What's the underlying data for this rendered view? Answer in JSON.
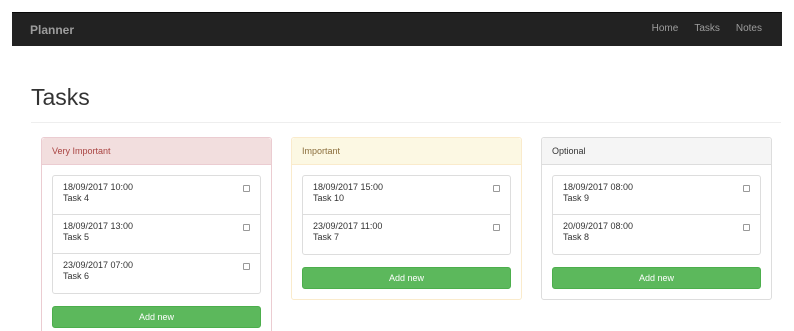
{
  "navbar": {
    "brand": "Planner",
    "links": [
      "Home",
      "Tasks",
      "Notes"
    ]
  },
  "page": {
    "title": "Tasks"
  },
  "panels": [
    {
      "heading": "Very Important",
      "tasks": [
        {
          "date": "18/09/2017 10:00",
          "name": "Task 4"
        },
        {
          "date": "18/09/2017 13:00",
          "name": "Task 5"
        },
        {
          "date": "23/09/2017 07:00",
          "name": "Task 6"
        }
      ],
      "add_label": "Add new"
    },
    {
      "heading": "Important",
      "tasks": [
        {
          "date": "18/09/2017 15:00",
          "name": "Task 10"
        },
        {
          "date": "23/09/2017 11:00",
          "name": "Task 7"
        }
      ],
      "add_label": "Add new"
    },
    {
      "heading": "Optional",
      "tasks": [
        {
          "date": "18/09/2017 08:00",
          "name": "Task 9"
        },
        {
          "date": "20/09/2017 08:00",
          "name": "Task 8"
        }
      ],
      "add_label": "Add new"
    }
  ],
  "colors": {
    "navbar_bg": "#222222",
    "success": "#5cb85c",
    "danger_heading": "#f2dede",
    "warning_heading": "#fcf8e3",
    "default_heading": "#f5f5f5"
  }
}
